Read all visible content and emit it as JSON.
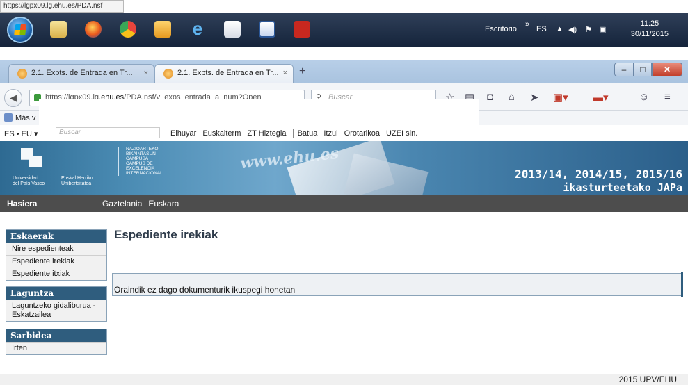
{
  "status_url": "https://lgpx09.lg.ehu.es/PDA.nsf",
  "taskbar": {
    "apps": [
      "start",
      "file-explorer",
      "firefox",
      "chrome",
      "outlook",
      "internet-explorer",
      "java",
      "word",
      "acrobat"
    ],
    "escritorio": "Escritorio",
    "chevron": "»",
    "lang": "ES",
    "time": "11:25",
    "date": "30/11/2015"
  },
  "browser": {
    "tabs": [
      {
        "label": "2.1. Expts. de Entrada en Tr...",
        "close": "×",
        "active": false
      },
      {
        "label": "2.1. Expts. de Entrada en Tr...",
        "close": "×",
        "active": true
      }
    ],
    "new_tab": "+",
    "url_prefix": "https://lgpx09.lg.",
    "url_domain": "ehu.es",
    "url_suffix": "/PDA.nsf/v_exps_entrada_a_num?Open",
    "search_placeholder": "Buscar",
    "bookmarks_label": "Más v"
  },
  "dictionary_bar": {
    "lang": "ES • EU  ▾",
    "search_placeholder": "Buscar",
    "links": [
      "Elhuyar",
      "Euskalterm",
      "ZT Hiztegia",
      "Batua",
      "Itzul",
      "Orotarikoa",
      "UZEI sin."
    ]
  },
  "banner": {
    "uni_left": "Universidad\ndel País Vasco",
    "uni_right": "Euskal Herriko\nUnibertsitatea",
    "campus_text": "NAZIOARTEKO\nBIKAINTASUN\nCAMPUSA\nCAMPUS DE\nEXCELENCIA\nINTERNACIONAL",
    "website": "www.ehu.es",
    "years": "2013/14, 2014/15, 2015/16",
    "subtitle": "ikasturteetako JAPa"
  },
  "site_nav": {
    "home": "Hasiera",
    "lang1": "Gaztelania",
    "lang2": "Euskara"
  },
  "sidebar": {
    "eskaerak": {
      "title": "Eskaerak",
      "items": [
        "Nire espedienteak",
        "Espediente irekiak",
        "Espediente itxiak"
      ]
    },
    "laguntza": {
      "title": "Laguntza",
      "items": [
        "Laguntzeko gidaliburua - Eskatzailea"
      ]
    },
    "sarbidea": {
      "title": "Sarbidea",
      "items": [
        "Irten"
      ]
    }
  },
  "main": {
    "title": "Espediente irekiak",
    "empty_message": "Oraindik ez dago dokumenturik ikuspegi honetan"
  },
  "footer": {
    "copyright": "2015 UPV/EHU"
  }
}
